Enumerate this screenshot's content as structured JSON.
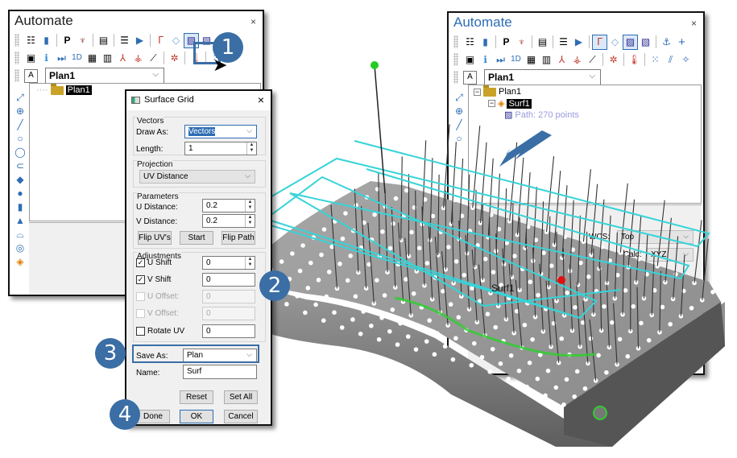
{
  "left_window": {
    "title": "Automate",
    "close": "×",
    "toolbar_row1": [
      "checklist-icon",
      "book-icon",
      "P",
      "probe-icon",
      "calculator-icon",
      "list-icon",
      "play-icon",
      "robot-arm-icon",
      "tag-icon",
      "hatch-path-icon",
      "hatch-path-multi-icon"
    ],
    "toolbar_row2": [
      "camera-icon",
      "info-icon",
      "step-icon",
      "1D",
      "report-icon",
      "table-icon",
      "axis-icon",
      "axis-multi-icon",
      "graph-icon",
      "probe-multi-icon",
      "thermometer-icon",
      "grid-points-icon"
    ],
    "plan_combo": "Plan1",
    "tree": [
      {
        "label": "Plan1",
        "selected": true
      }
    ],
    "side_tools": [
      "point-add-icon",
      "crosshair-icon",
      "line-icon",
      "circle-icon",
      "ellipse-icon",
      "slot-icon",
      "plane-icon",
      "sphere-icon",
      "cylinder-icon",
      "cone-icon",
      "torus-icon",
      "ring-icon",
      "surface-icon"
    ]
  },
  "right_window": {
    "title": "Automate",
    "close": "×",
    "toolbar_row1": [
      "checklist-icon",
      "book-icon",
      "P",
      "probe-icon",
      "calculator-icon",
      "list-icon",
      "play-icon",
      "robot-arm-icon",
      "tag-icon",
      "hatch-path-icon",
      "hatch-path-multi-icon",
      "anchor-icon",
      "+"
    ],
    "toolbar_row2": [
      "camera-icon",
      "info-icon",
      "step-icon",
      "1D",
      "report-icon",
      "table-icon",
      "axis-icon",
      "axis-multi-icon",
      "graph-icon",
      "probe-multi-icon",
      "thermometer-icon",
      "grid-points-icon",
      "vectors-icon",
      "scatter-icon"
    ],
    "plan_combo": "Plan1",
    "tree": [
      {
        "label": "Plan1",
        "level": 0
      },
      {
        "label": "Surf1",
        "level": 1,
        "selected": true
      },
      {
        "label": "Path: 270 points",
        "level": 2
      }
    ],
    "props": {
      "wcs_label": "WCS:",
      "wcs_value": "Top",
      "dist_label": "Dist Pos. Calc:",
      "dist_value": "XYZ"
    }
  },
  "dialog": {
    "title": "Surface Grid",
    "close": "×",
    "vectors_group": "Vectors",
    "draw_as_label": "Draw As:",
    "draw_as_value": "Vectors",
    "length_label": "Length:",
    "length_value": "1",
    "projection_group": "Projection",
    "projection_value": "UV Distance",
    "parameters_group": "Parameters",
    "u_distance_label": "U Distance:",
    "u_distance_value": "0.2",
    "v_distance_label": "V Distance:",
    "v_distance_value": "0.2",
    "flip_uvs": "Flip UV's",
    "start": "Start",
    "flip_path": "Flip Path",
    "adjustments_group": "Adjustments",
    "u_shift_label": "U Shift",
    "u_shift_checked": true,
    "u_shift_value": "0",
    "v_shift_label": "V Shift",
    "v_shift_checked": true,
    "v_shift_value": "0",
    "u_offset_label": "U Offset:",
    "u_offset_value": "0",
    "v_offset_label": "V Offset:",
    "v_offset_value": "0",
    "rotate_uv_label": "Rotate UV",
    "rotate_uv_checked": false,
    "rotate_uv_value": "0",
    "save_as_label": "Save As:",
    "save_as_value": "Plan",
    "name_label": "Name:",
    "name_value": "Surf",
    "reset": "Reset",
    "set_all": "Set All",
    "done": "Done",
    "ok": "OK",
    "cancel": "Cancel"
  },
  "viewport": {
    "surface_label": "Surf1",
    "colors": {
      "path": "#36d4d8",
      "vector": "#333333",
      "part": "#8a8a8a",
      "start_point": "#22cc22",
      "end_point": "#e01010"
    }
  },
  "callouts": [
    "1",
    "2",
    "3",
    "4"
  ]
}
